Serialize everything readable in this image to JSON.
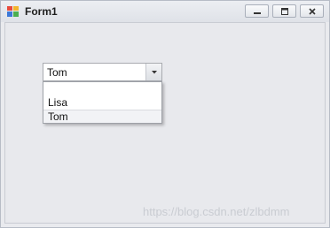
{
  "window": {
    "title": "Form1",
    "controls": {
      "minimize_icon": "minimize-icon",
      "maximize_icon": "maximize-icon",
      "close_icon": "close-icon"
    }
  },
  "combo": {
    "selected_value": "Tom",
    "items": [
      "",
      "Lisa",
      "Tom"
    ],
    "selected_index": 2
  },
  "watermark": "https://blog.csdn.net/zlbdmm",
  "colors": {
    "window_bg": "#e9eaee",
    "border": "#b7bcc6",
    "combo_border": "#a9abb0"
  }
}
